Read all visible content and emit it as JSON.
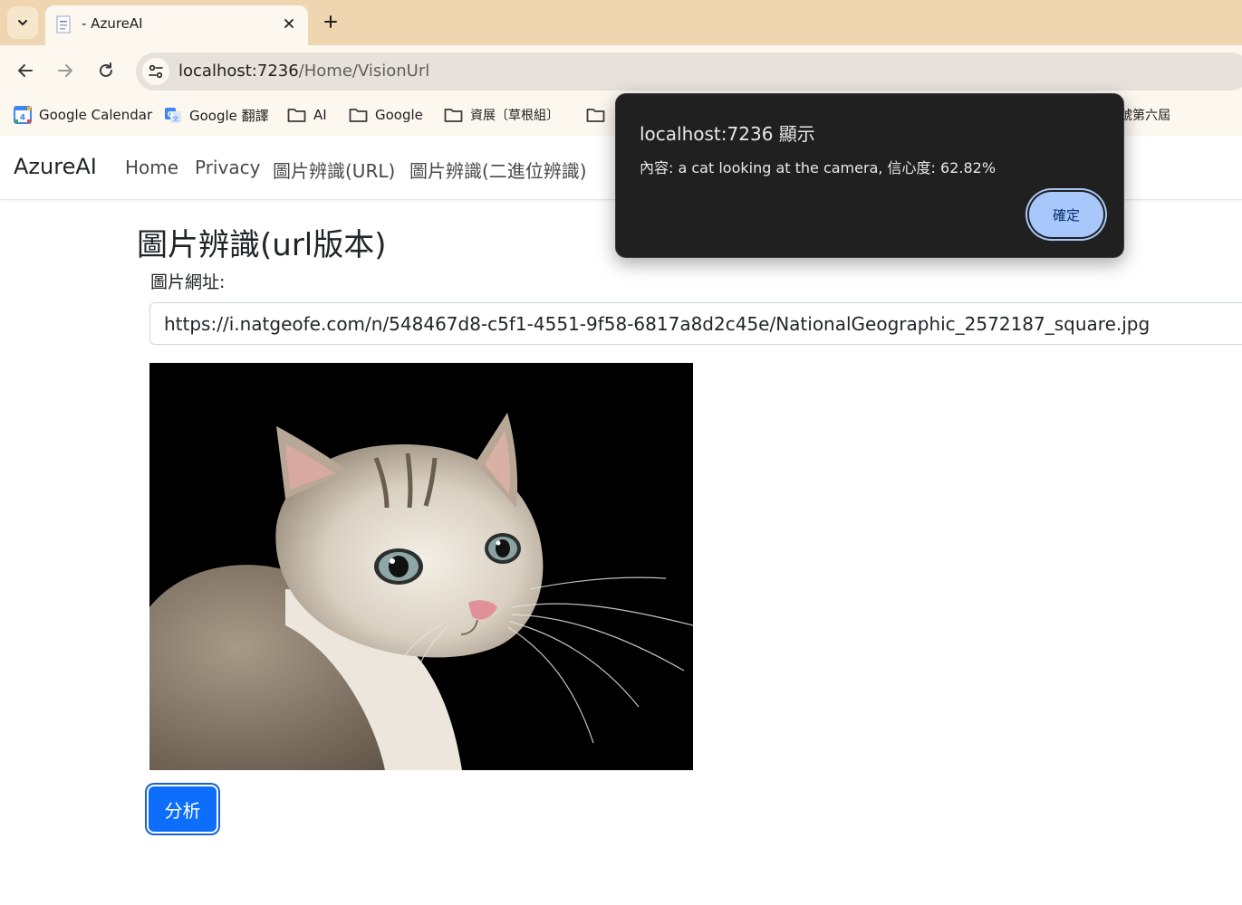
{
  "browser": {
    "tab_title": "- AzureAI",
    "url_host": "localhost:7236",
    "url_path": "/Home/VisionUrl",
    "bookmarks": [
      {
        "label": "Google Calendar",
        "icon": "calendar-icon"
      },
      {
        "label": "Google 翻譯",
        "icon": "translate-icon"
      },
      {
        "label": "AI",
        "icon": "folder-icon"
      },
      {
        "label": "Google",
        "icon": "folder-icon"
      },
      {
        "label": "資展〔草根組〕",
        "icon": "folder-icon"
      },
      {
        "label": "",
        "icon": "folder-icon"
      },
      {
        "label": "號第六屆",
        "icon": ""
      }
    ]
  },
  "navbar": {
    "brand": "AzureAI",
    "links": [
      "Home",
      "Privacy",
      "圖片辨識(URL)",
      "圖片辨識(二進位辨識)"
    ]
  },
  "main": {
    "title": "圖片辨識(url版本)",
    "field_label": "圖片網址:",
    "image_url": "https://i.natgeofe.com/n/548467d8-c5f1-4551-9f58-6817a8d2c45e/NationalGeographic_2572187_square.jpg",
    "analyze_label": "分析"
  },
  "alert": {
    "title": "localhost:7236 顯示",
    "message": "內容: a cat looking at the camera, 信心度: 62.82%",
    "ok_label": "確定"
  },
  "colors": {
    "tabstrip": "#efd6b1",
    "toolbar": "#fcf7ef",
    "primary_button": "#0d6efd",
    "dialog_bg": "#202020",
    "dialog_button": "#a8c7fa"
  }
}
